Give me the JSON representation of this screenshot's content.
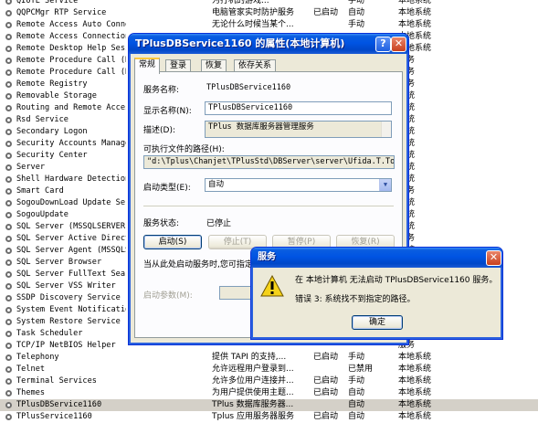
{
  "services": [
    {
      "name": "QIOTE Service",
      "desc": "为打机的游戏...",
      "status": "",
      "type": "手动",
      "logon": "本地系统"
    },
    {
      "name": "QQPCMgr RTP Service",
      "desc": "电脑管家实时防护服务",
      "status": "已启动",
      "type": "自动",
      "logon": "本地系统"
    },
    {
      "name": "Remote Access Auto Connection Manager",
      "desc": "无论什么时候当某个...",
      "status": "",
      "type": "手动",
      "logon": "本地系统"
    },
    {
      "name": "Remote Access Connection Manager",
      "desc": "",
      "status": "",
      "type": "",
      "logon": "本地系统"
    },
    {
      "name": "Remote Desktop Help Session Manager",
      "desc": "",
      "status": "",
      "type": "",
      "logon": "本地系统"
    },
    {
      "name": "Remote Procedure Call (RPC)",
      "desc": "",
      "status": "",
      "type": "",
      "logon": "服务"
    },
    {
      "name": "Remote Procedure Call (RPC) Locator",
      "desc": "",
      "status": "",
      "type": "",
      "logon": "服务"
    },
    {
      "name": "Remote Registry",
      "desc": "",
      "status": "",
      "type": "",
      "logon": "服务"
    },
    {
      "name": "Removable Storage",
      "desc": "",
      "status": "",
      "type": "",
      "logon": "系统"
    },
    {
      "name": "Routing and Remote Access",
      "desc": "",
      "status": "",
      "type": "",
      "logon": "系统"
    },
    {
      "name": "Rsd Service",
      "desc": "",
      "status": "",
      "type": "",
      "logon": "系统"
    },
    {
      "name": "Secondary Logon",
      "desc": "",
      "status": "",
      "type": "",
      "logon": "系统"
    },
    {
      "name": "Security Accounts Manager",
      "desc": "",
      "status": "",
      "type": "",
      "logon": "系统"
    },
    {
      "name": "Security Center",
      "desc": "",
      "status": "",
      "type": "",
      "logon": "系统"
    },
    {
      "name": "Server",
      "desc": "",
      "status": "",
      "type": "",
      "logon": "系统"
    },
    {
      "name": "Shell Hardware Detection",
      "desc": "",
      "status": "",
      "type": "",
      "logon": "系统"
    },
    {
      "name": "Smart Card",
      "desc": "",
      "status": "",
      "type": "",
      "logon": "服务"
    },
    {
      "name": "SogouDownLoad Update Service",
      "desc": "",
      "status": "",
      "type": "",
      "logon": "系统"
    },
    {
      "name": "SogouUpdate",
      "desc": "",
      "status": "",
      "type": "",
      "logon": "系统"
    },
    {
      "name": "SQL Server (MSSQLSERVER)",
      "desc": "",
      "status": "",
      "type": "",
      "logon": "系统"
    },
    {
      "name": "SQL Server Active Directory Helper",
      "desc": "",
      "status": "",
      "type": "",
      "logon": "服务"
    },
    {
      "name": "SQL Server Agent (MSSQLSERVER)",
      "desc": "",
      "status": "",
      "type": "",
      "logon": "系统"
    },
    {
      "name": "SQL Server Browser",
      "desc": "",
      "status": "",
      "type": "",
      "logon": "系统"
    },
    {
      "name": "SQL Server FullText Search",
      "desc": "",
      "status": "",
      "type": "",
      "logon": "系统"
    },
    {
      "name": "SQL Server VSS Writer",
      "desc": "",
      "status": "",
      "type": "",
      "logon": "系统"
    },
    {
      "name": "SSDP Discovery Service",
      "desc": "",
      "status": "",
      "type": "",
      "logon": "服务"
    },
    {
      "name": "System Event Notification",
      "desc": "",
      "status": "",
      "type": "",
      "logon": "系统"
    },
    {
      "name": "System Restore Service",
      "desc": "",
      "status": "",
      "type": "",
      "logon": "系统"
    },
    {
      "name": "Task Scheduler",
      "desc": "",
      "status": "",
      "type": "",
      "logon": "系统"
    },
    {
      "name": "TCP/IP NetBIOS Helper",
      "desc": "",
      "status": "",
      "type": "",
      "logon": "服务"
    },
    {
      "name": "Telephony",
      "desc": "提供 TAPI 的支持,...",
      "status": "已启动",
      "type": "手动",
      "logon": "本地系统"
    },
    {
      "name": "Telnet",
      "desc": "允许远程用户登录到...",
      "status": "",
      "type": "已禁用",
      "logon": "本地系统"
    },
    {
      "name": "Terminal Services",
      "desc": "允许多位用户连接并...",
      "status": "已启动",
      "type": "手动",
      "logon": "本地系统"
    },
    {
      "name": "Themes",
      "desc": "为用户提供使用主题...",
      "status": "已启动",
      "type": "自动",
      "logon": "本地系统"
    },
    {
      "name": "TPlusDBService1160",
      "desc": "TPlus 数据库服务器...",
      "status": "",
      "type": "自动",
      "logon": "本地系统"
    },
    {
      "name": "TPlusService1160",
      "desc": "Tplus 应用服务器服务",
      "status": "已启动",
      "type": "自动",
      "logon": "本地系统"
    }
  ],
  "selected_index": 34,
  "props": {
    "title": "TPlusDBService1160 的属性(本地计算机)",
    "help_btn": "?",
    "close_btn": "✕",
    "tabs": [
      "常规",
      "登录",
      "恢复",
      "依存关系"
    ],
    "service_name_label": "服务名称:",
    "service_name": "TPlusDBService1160",
    "display_name_label": "显示名称(N):",
    "display_name": "TPlusDBService1160",
    "desc_label": "描述(D):",
    "desc": "TPlus 数据库服务器管理服务",
    "path_label": "可执行文件的路径(H):",
    "path": "\"d:\\Tplus\\Chanjet\\TPlusStd\\DBServer\\server\\Ufida.T.Tool.SQLExpressService.exe\"",
    "startup_label": "启动类型(E):",
    "startup_value": "自动",
    "status_label": "服务状态:",
    "status_value": "已停止",
    "btn_start": "启动(S)",
    "btn_stop": "停止(T)",
    "btn_pause": "暂停(P)",
    "btn_resume": "恢复(R)",
    "hint": "当从此处启动服务时,您可指定所适用的启动参数。",
    "param_label": "启动参数(M):"
  },
  "error": {
    "title": "服务",
    "close_btn": "✕",
    "line1": "在 本地计算机 无法启动 TPlusDBService1160 服务。",
    "line2": "错误 3: 系统找不到指定的路径。",
    "ok": "确定"
  }
}
